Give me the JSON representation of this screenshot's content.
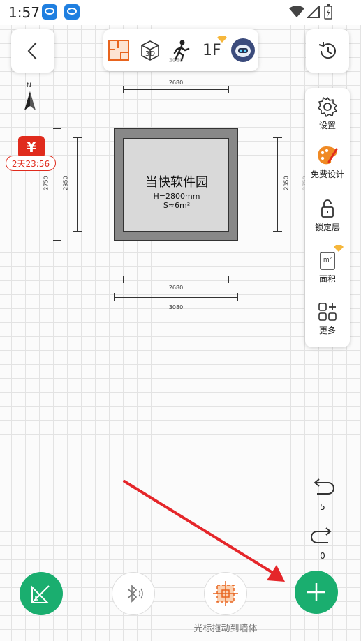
{
  "status": {
    "time": "1:57"
  },
  "toolbar": {
    "floor_label": "1F"
  },
  "compass": {
    "label": "N"
  },
  "promo": {
    "currency_symbol": "¥",
    "countdown": "2天23:56"
  },
  "room": {
    "name": "当快软件园",
    "height": "H=2800mm",
    "area": "S≈6m²"
  },
  "dimensions": {
    "top_inner": "2680",
    "top_outer": "3080",
    "bottom_inner": "2680",
    "bottom_outer": "3080",
    "left_outer": "2750",
    "left_inner": "2350",
    "right_inner": "2350",
    "right_outer": "2750"
  },
  "side_tools": [
    {
      "label": "设置",
      "icon": "gear-icon"
    },
    {
      "label": "免费设计",
      "icon": "palette-icon"
    },
    {
      "label": "锁定层",
      "icon": "lock-icon"
    },
    {
      "label": "面积",
      "icon": "area-icon",
      "sub": "m²"
    },
    {
      "label": "更多",
      "icon": "grid-plus-icon"
    }
  ],
  "history": {
    "undo_count": "5",
    "redo_count": "0"
  },
  "bottom": {
    "cursor_hint": "光标拖动到墙体"
  },
  "colors": {
    "accent_orange": "#e8641e",
    "green": "#1aae6f",
    "red_promo": "#e02b1d"
  }
}
